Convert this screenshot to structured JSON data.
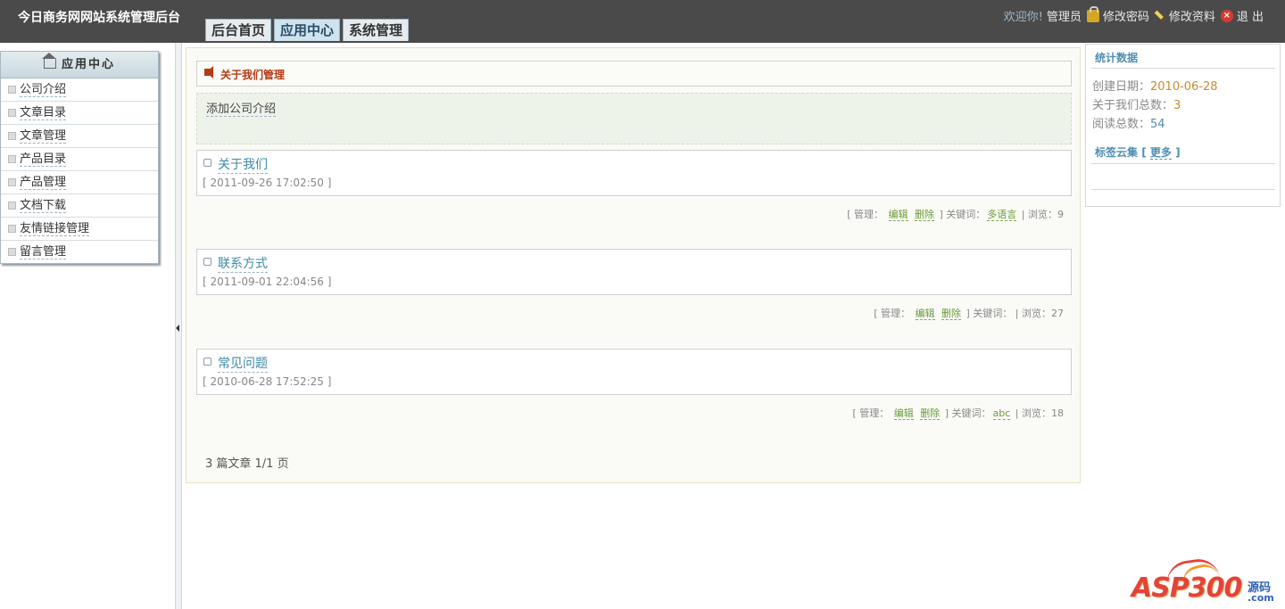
{
  "header": {
    "site_title": "今日商务网网站系统管理后台",
    "tabs": [
      "后台首页",
      "应用中心",
      "系统管理"
    ],
    "active_tab": "应用中心",
    "welcome": "欢迎你!",
    "user": "管理员",
    "change_password": "修改密码",
    "edit_profile": "修改资料",
    "logout": "退 出"
  },
  "sidebar": {
    "title": "应用中心",
    "items": [
      "公司介绍",
      "文章目录",
      "文章管理",
      "产品目录",
      "产品管理",
      "文档下载",
      "友情链接管理",
      "留言管理"
    ]
  },
  "main": {
    "section_title": "关于我们管理",
    "add_link": "添加公司介绍",
    "articles": [
      {
        "title": "关于我们",
        "date": "[ 2011-09-26 17:02:50 ]",
        "manage": "[ 管理：",
        "edit": "编辑",
        "delete": "删除",
        "kw_label": "] 关键词：",
        "keyword": "多语言",
        "views": "| 浏览：9"
      },
      {
        "title": "联系方式",
        "date": "[ 2011-09-01 22:04:56 ]",
        "manage": "[ 管理：",
        "edit": "编辑",
        "delete": "删除",
        "kw_label": "] 关键词：",
        "keyword": "",
        "views": "| 浏览：27"
      },
      {
        "title": "常见问题",
        "date": "[ 2010-06-28 17:52:25 ]",
        "manage": "[ 管理：",
        "edit": "编辑",
        "delete": "删除",
        "kw_label": "] 关键词：",
        "keyword": "abc",
        "views": "| 浏览：18"
      }
    ],
    "pager": "3 篇文章  1/1 页"
  },
  "stats": {
    "title": "统计数据",
    "created_label": "创建日期：",
    "created_value": "2010-06-28",
    "total_label": "关于我们总数：",
    "total_value": "3",
    "reads_label": "阅读总数：",
    "reads_value": "54",
    "tags_title": "标签云集",
    "tags_more": "更多",
    "tags_open": "[",
    "tags_close": "]"
  },
  "watermark": {
    "brand": "ASP300",
    "cn": "源码",
    "com": ".com"
  },
  "colors": {
    "topbar": "#4a4a4a",
    "link_blue": "#3d8aa6",
    "accent_red": "#b33a14",
    "action_green": "#6a9b3a"
  }
}
